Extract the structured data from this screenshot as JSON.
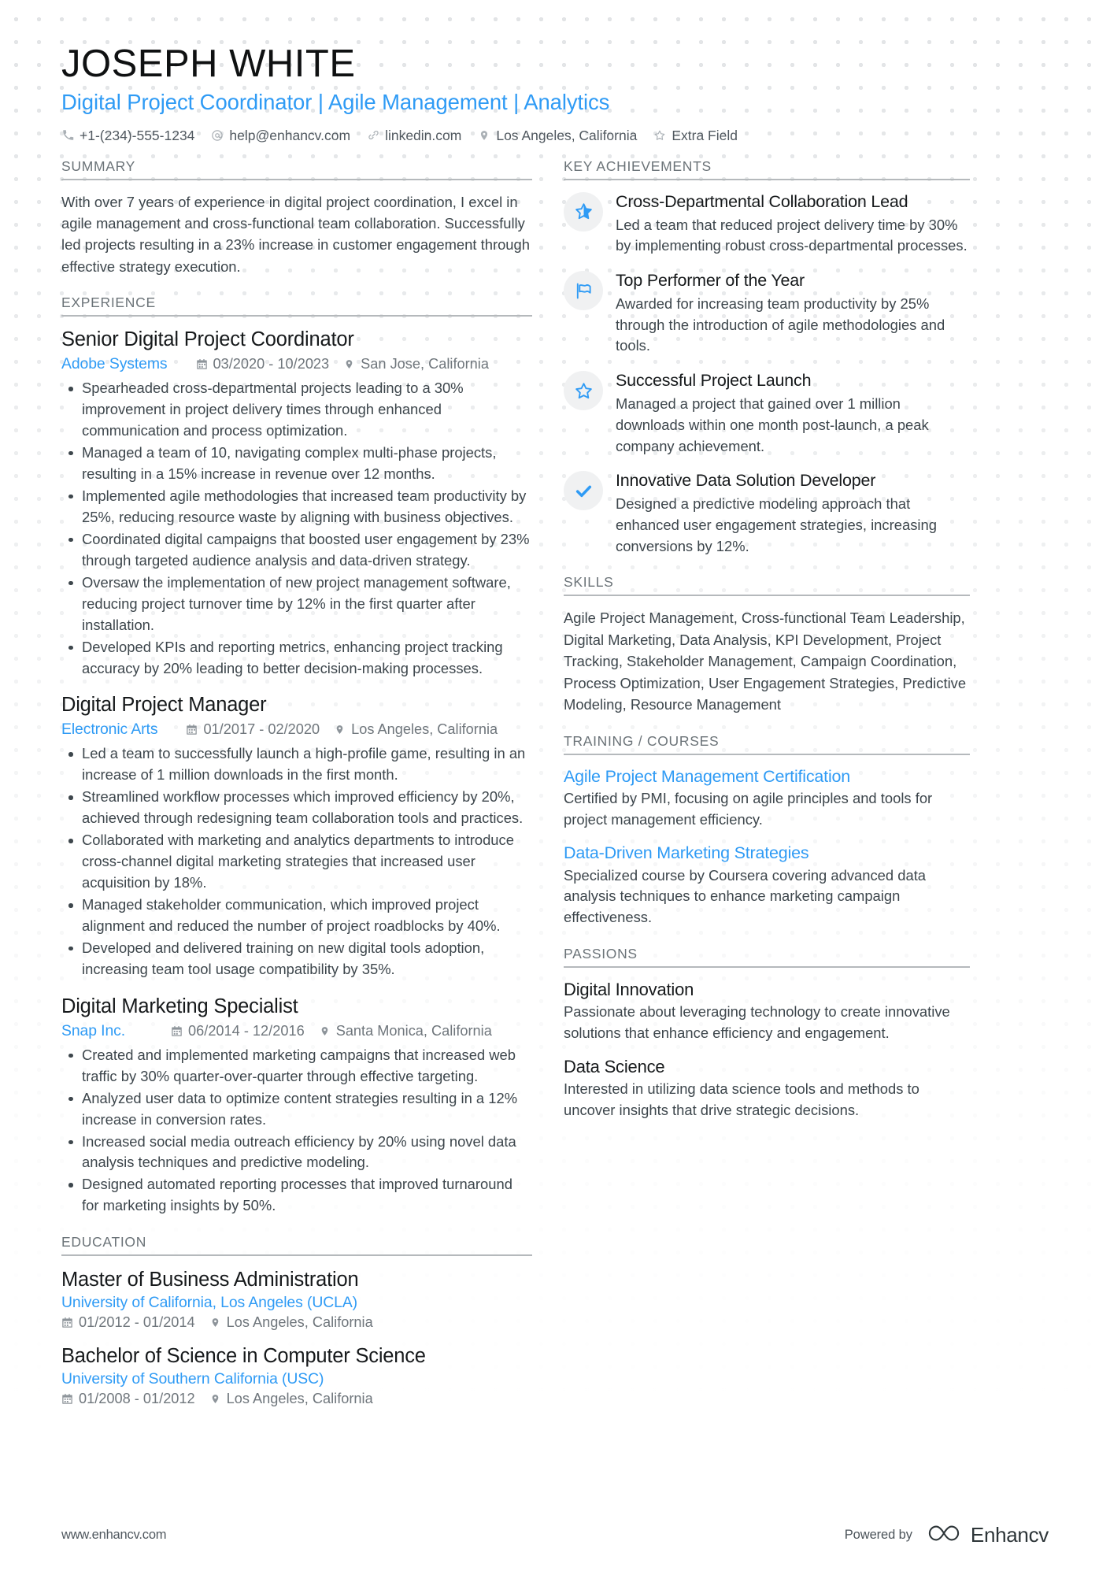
{
  "colors": {
    "accent": "#2f9bf5",
    "heading": "#16191b",
    "body": "#3d464c",
    "muted": "#6b7378",
    "badge_bg": "#f0f1f2"
  },
  "header": {
    "name": "JOSEPH WHITE",
    "headline": "Digital Project Coordinator | Agile Management | Analytics",
    "contacts": [
      {
        "icon": "phone-icon",
        "text": "+1-(234)-555-1234"
      },
      {
        "icon": "email-icon",
        "text": "help@enhancv.com"
      },
      {
        "icon": "link-icon",
        "text": "linkedin.com"
      },
      {
        "icon": "location-icon",
        "text": "Los Angeles, California"
      },
      {
        "icon": "star-icon",
        "text": "Extra Field"
      }
    ]
  },
  "left": {
    "summary": {
      "title": "SUMMARY",
      "text": "With over 7 years of experience in digital project coordination, I excel in agile management and cross-functional team collaboration. Successfully led projects resulting in a 23% increase in customer engagement through effective strategy execution."
    },
    "experience": {
      "title": "EXPERIENCE",
      "entries": [
        {
          "role": "Senior Digital Project Coordinator",
          "company": "Adobe Systems",
          "dates": "03/2020 - 10/2023",
          "location": "San Jose, California",
          "bullets": [
            "Spearheaded cross-departmental projects leading to a 30% improvement in project delivery times through enhanced communication and process optimization.",
            "Managed a team of 10, navigating complex multi-phase projects, resulting in a 15% increase in revenue over 12 months.",
            "Implemented agile methodologies that increased team productivity by 25%, reducing resource waste by aligning with business objectives.",
            "Coordinated digital campaigns that boosted user engagement by 23% through targeted audience analysis and data-driven strategy.",
            "Oversaw the implementation of new project management software, reducing project turnover time by 12% in the first quarter after installation.",
            "Developed KPIs and reporting metrics, enhancing project tracking accuracy by 20% leading to better decision-making processes."
          ]
        },
        {
          "role": "Digital Project Manager",
          "company": "Electronic Arts",
          "dates": "01/2017 - 02/2020",
          "location": "Los Angeles, California",
          "bullets": [
            "Led a team to successfully launch a high-profile game, resulting in an increase of 1 million downloads in the first month.",
            "Streamlined workflow processes which improved efficiency by 20%, achieved through redesigning team collaboration tools and practices.",
            "Collaborated with marketing and analytics departments to introduce cross-channel digital marketing strategies that increased user acquisition by 18%.",
            "Managed stakeholder communication, which improved project alignment and reduced the number of project roadblocks by 40%.",
            "Developed and delivered training on new digital tools adoption, increasing team tool usage compatibility by 35%."
          ]
        },
        {
          "role": "Digital Marketing Specialist",
          "company": "Snap Inc.",
          "dates": "06/2014 - 12/2016",
          "location": "Santa Monica, California",
          "bullets": [
            "Created and implemented marketing campaigns that increased web traffic by 30% quarter-over-quarter through effective targeting.",
            "Analyzed user data to optimize content strategies resulting in a 12% increase in conversion rates.",
            "Increased social media outreach efficiency by 20% using novel data analysis techniques and predictive modeling.",
            "Designed automated reporting processes that improved turnaround for marketing insights by 50%."
          ]
        }
      ]
    },
    "education": {
      "title": "EDUCATION",
      "entries": [
        {
          "degree": "Master of Business Administration",
          "school": "University of California, Los Angeles (UCLA)",
          "dates": "01/2012 - 01/2014",
          "location": "Los Angeles, California"
        },
        {
          "degree": "Bachelor of Science in Computer Science",
          "school": "University of Southern California (USC)",
          "dates": "01/2008 - 01/2012",
          "location": "Los Angeles, California"
        }
      ]
    }
  },
  "right": {
    "achievements": {
      "title": "KEY ACHIEVEMENTS",
      "items": [
        {
          "icon": "star-filled-icon",
          "title": "Cross-Departmental Collaboration Lead",
          "desc": "Led a team that reduced project delivery time by 30% by implementing robust cross-departmental processes."
        },
        {
          "icon": "flag-icon",
          "title": "Top Performer of the Year",
          "desc": "Awarded for increasing team productivity by 25% through the introduction of agile methodologies and tools."
        },
        {
          "icon": "star-outline-icon",
          "title": "Successful Project Launch",
          "desc": "Managed a project that gained over 1 million downloads within one month post-launch, a peak company achievement."
        },
        {
          "icon": "check-icon",
          "title": "Innovative Data Solution Developer",
          "desc": "Designed a predictive modeling approach that enhanced user engagement strategies, increasing conversions by 12%."
        }
      ]
    },
    "skills": {
      "title": "SKILLS",
      "text": "Agile Project Management, Cross-functional Team Leadership, Digital Marketing, Data Analysis, KPI Development, Project Tracking, Stakeholder Management, Campaign Coordination, Process Optimization, User Engagement Strategies, Predictive Modeling, Resource Management"
    },
    "training": {
      "title": "TRAINING / COURSES",
      "items": [
        {
          "title": "Agile Project Management Certification",
          "desc": "Certified by PMI, focusing on agile principles and tools for project management efficiency."
        },
        {
          "title": "Data-Driven Marketing Strategies",
          "desc": "Specialized course by Coursera covering advanced data analysis techniques to enhance marketing campaign effectiveness."
        }
      ]
    },
    "passions": {
      "title": "PASSIONS",
      "items": [
        {
          "title": "Digital Innovation",
          "desc": "Passionate about leveraging technology to create innovative solutions that enhance efficiency and engagement."
        },
        {
          "title": "Data Science",
          "desc": "Interested in utilizing data science tools and methods to uncover insights that drive strategic decisions."
        }
      ]
    }
  },
  "footer": {
    "url": "www.enhancv.com",
    "powered_by": "Powered by",
    "brand": "Enhancv"
  }
}
